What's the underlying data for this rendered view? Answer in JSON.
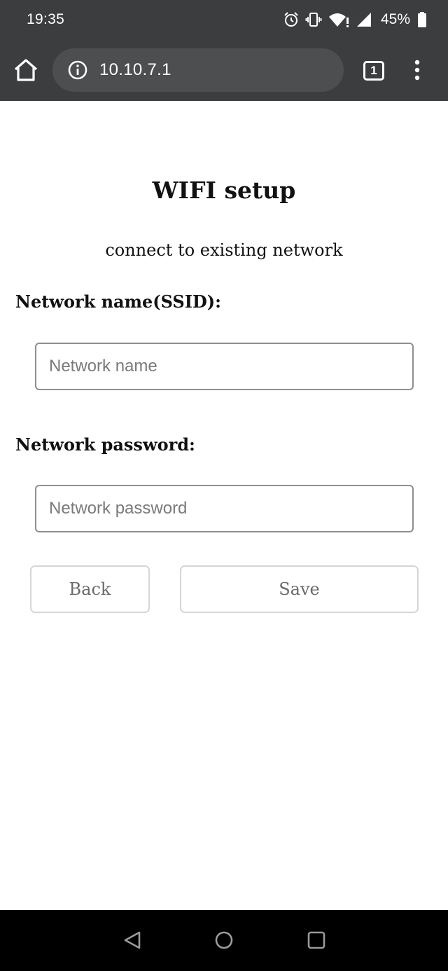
{
  "status_bar": {
    "time": "19:35",
    "battery_percent": "45%",
    "icons": [
      "alarm-icon",
      "vibrate-icon",
      "wifi-icon",
      "cell-signal-icon",
      "battery-icon"
    ]
  },
  "browser": {
    "url": "10.10.7.1",
    "tab_count": "1",
    "icons": [
      "home-icon",
      "info-icon",
      "tab-switcher-icon",
      "more-menu-icon"
    ]
  },
  "page": {
    "title": "WIFI setup",
    "subtitle": "connect to existing network",
    "ssid_label": "Network name(SSID):",
    "ssid_placeholder": "Network name",
    "password_label": "Network password:",
    "password_placeholder": "Network password",
    "back_label": "Back",
    "save_label": "Save"
  },
  "nav_bar": {
    "icons": [
      "nav-back-icon",
      "nav-home-icon",
      "nav-recents-icon"
    ]
  },
  "colors": {
    "chrome_background": "#3c3d3f",
    "url_box": "#4d4e50",
    "page_background": "#ffffff",
    "input_border": "#8f8f8f",
    "button_border": "#d6d6d6",
    "nav_background": "#000000"
  }
}
